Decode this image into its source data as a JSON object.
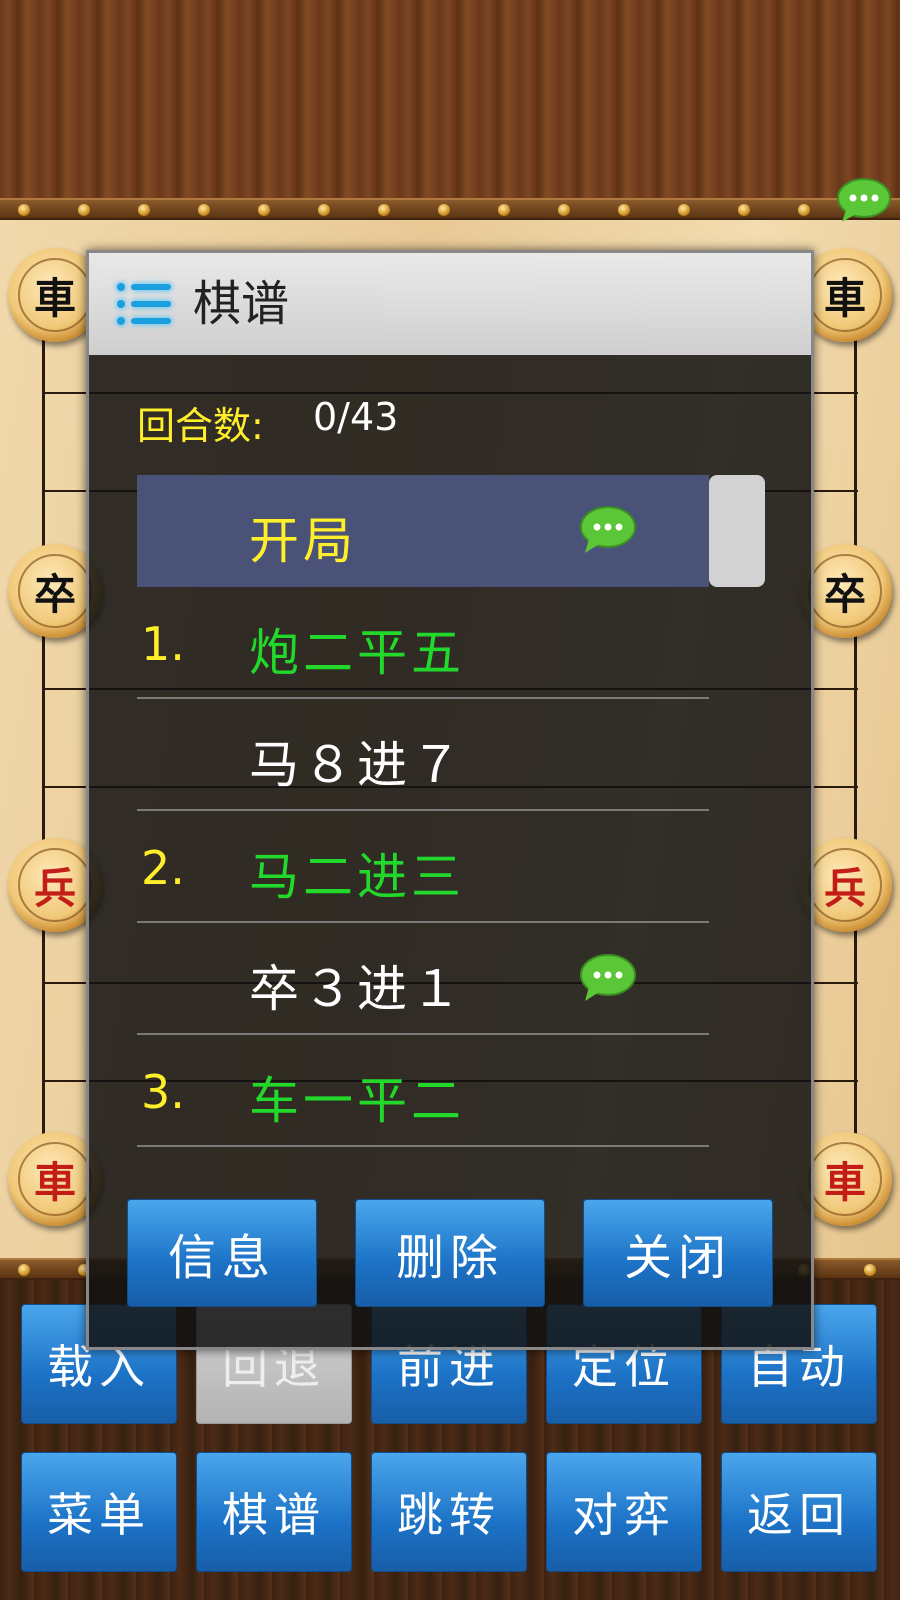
{
  "dialog": {
    "title": "棋谱",
    "round_label": "回合数:",
    "round_value": "0/43",
    "moves": [
      {
        "number": "",
        "text": "开局",
        "side": "start",
        "selected": true,
        "has_comment": true
      },
      {
        "number": "1.",
        "text": "炮二平五",
        "side": "red",
        "selected": false,
        "has_comment": false
      },
      {
        "number": "",
        "text": "马８进７",
        "side": "black",
        "selected": false,
        "has_comment": false
      },
      {
        "number": "2.",
        "text": "马二进三",
        "side": "red",
        "selected": false,
        "has_comment": false
      },
      {
        "number": "",
        "text": "卒３进１",
        "side": "black",
        "selected": false,
        "has_comment": true
      },
      {
        "number": "3.",
        "text": "车一平二",
        "side": "red",
        "selected": false,
        "has_comment": false
      }
    ],
    "buttons": {
      "info": "信息",
      "delete": "删除",
      "close": "关闭"
    }
  },
  "toolbar": {
    "row1": {
      "load": "载入",
      "undo": "回退",
      "forward": "前进",
      "locate": "定位",
      "auto": "自动"
    },
    "row2": {
      "menu": "菜单",
      "record": "棋谱",
      "jump": "跳转",
      "play": "对弈",
      "back": "返回"
    }
  },
  "board_pieces": {
    "black_chariot": "車",
    "black_soldier": "卒",
    "red_soldier": "兵",
    "red_chariot": "車"
  },
  "colors": {
    "red_move": "#22d82a",
    "move_number": "#ffef2a",
    "button_blue": "#1c72c6"
  }
}
